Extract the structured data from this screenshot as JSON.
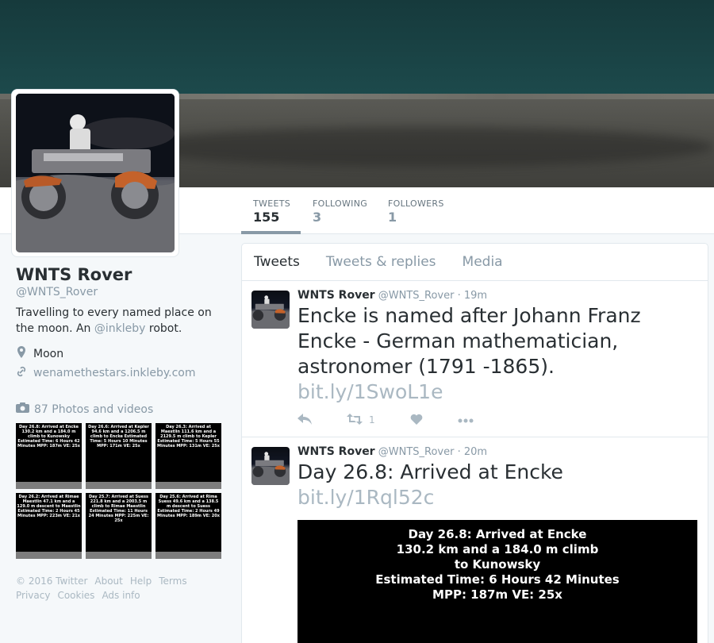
{
  "stats": [
    {
      "label": "TWEETS",
      "value": "155"
    },
    {
      "label": "FOLLOWING",
      "value": "3"
    },
    {
      "label": "FOLLOWERS",
      "value": "1"
    }
  ],
  "profile": {
    "name": "WNTS Rover",
    "handle": "@WNTS_Rover",
    "bio_before": "Travelling to every named place on the moon. An ",
    "bio_mention": "@inkleby",
    "bio_after": " robot.",
    "location": "Moon",
    "url": "wenamethestars.inkleby.com",
    "photos_label": "87 Photos and videos"
  },
  "thumbnails": [
    {
      "text": "Day 26.8: Arrived at Encke 130.2 km and a 184.0 m climb to Kunowsky Estimated Time: 6 Hours 42 Minutes MPP: 187m VE: 25x"
    },
    {
      "text": "Day 26.6: Arrived at Kepler 94.6 km and a 1206.5 m climb to Encke Estimated Time: 5 Hours 10 Minutes MPP: 171m VE: 25x"
    },
    {
      "text": "Day 26.3: Arrived at Maestlin 111.6 km and a 2129.5 m climb to Kepler Estimated Time: 5 Hours 55 Minutes MPP: 131m VE: 25x"
    },
    {
      "text": "Day 26.2: Arrived at Rimae Maestlin 47.1 km and a 129.0 m descent to Maestlin Estimated Time: 2 Hours 45 Minutes MPP: 223m VE: 21x"
    },
    {
      "text": "Day 25.7: Arrived at Suess 221.8 km and a 2003.5 m climb to Rimae Maestlin Estimated Time: 11 Hours 24 Minutes MPP: 225m VE: 25x"
    },
    {
      "text": "Day 25.6: Arrived at Rima Suess 49.6 km and a 138.5 m descent to Suess Estimated Time: 2 Hours 49 Minutes MPP: 189m VE: 20x"
    }
  ],
  "footer": [
    "© 2016 Twitter",
    "About",
    "Help",
    "Terms",
    "Privacy",
    "Cookies",
    "Ads info"
  ],
  "tabs": [
    "Tweets",
    "Tweets & replies",
    "Media"
  ],
  "tweets": [
    {
      "name": "WNTS Rover",
      "handle": "@WNTS_Rover",
      "time": "· 19m",
      "text": "Encke is named after Johann Franz Encke - German mathematician, astronomer (1791 -1865).",
      "link": "bit.ly/1SwoL1e",
      "retweets": "1"
    },
    {
      "name": "WNTS Rover",
      "handle": "@WNTS_Rover",
      "time": "· 20m",
      "text": "Day 26.8: Arrived at Encke",
      "link": "bit.ly/1Rql52c",
      "media_lines": [
        "Day 26.8: Arrived at Encke",
        "130.2 km and a 184.0 m climb",
        "to Kunowsky",
        "Estimated Time: 6 Hours 42 Minutes",
        "MPP: 187m VE: 25x"
      ]
    }
  ],
  "icons": {
    "location": "map-pin",
    "link": "link",
    "photos": "camera",
    "reply": "reply-arrow",
    "retweet": "retweet",
    "like": "heart",
    "more": "ellipsis"
  }
}
